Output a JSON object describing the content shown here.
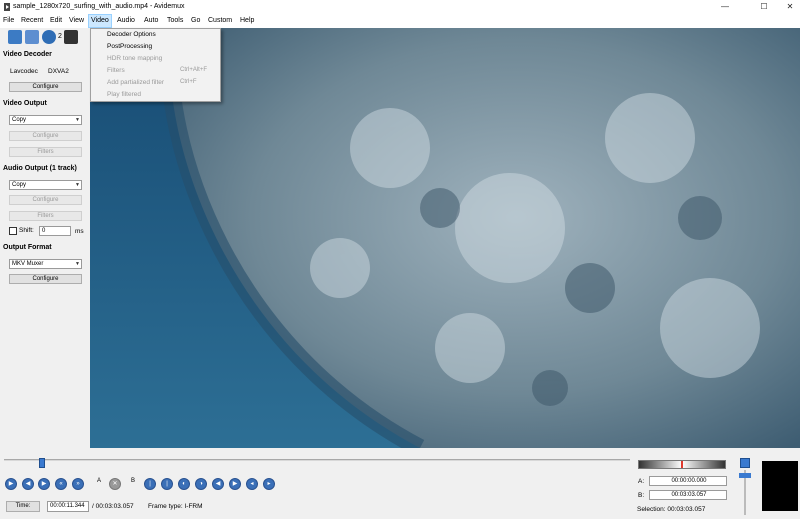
{
  "window": {
    "title": "sample_1280x720_surfing_with_audio.mp4 - Avidemux",
    "minimize": "—",
    "maximize": "☐",
    "close": "✕"
  },
  "menubar": {
    "items": [
      "File",
      "Recent",
      "Edit",
      "View",
      "Video",
      "Audio",
      "Auto",
      "Tools",
      "Go",
      "Custom",
      "Help"
    ]
  },
  "video_menu": {
    "items": [
      {
        "label": "Decoder Options",
        "shortcut": ""
      },
      {
        "label": "PostProcessing",
        "shortcut": ""
      },
      {
        "label": "HDR tone mapping",
        "shortcut": ""
      },
      {
        "label": "Filters",
        "shortcut": "Ctrl+Alt+F"
      },
      {
        "label": "Add partialized filter",
        "shortcut": "Ctrl+F"
      },
      {
        "label": "Play filtered",
        "shortcut": ""
      }
    ]
  },
  "toolbar": {
    "partial_label": "2"
  },
  "left_panel": {
    "video_decoder": {
      "title": "Video Decoder",
      "decoder": "Lavcodec",
      "hw": "DXVA2",
      "configure": "Configure"
    },
    "video_output": {
      "title": "Video Output",
      "codec": "Copy",
      "configure": "Configure",
      "filters": "Filters"
    },
    "audio_output": {
      "title": "Audio Output (1 track)",
      "codec": "Copy",
      "configure": "Configure",
      "filters": "Filters",
      "shift_label": "Shift:",
      "shift_value": "0",
      "shift_unit": "ms"
    },
    "output_format": {
      "title": "Output Format",
      "muxer": "MKV Muxer",
      "configure": "Configure"
    }
  },
  "playback": {
    "time_button": "Time:",
    "current_time": "00:00:11.344",
    "total_time": "/ 00:03:03.057",
    "frame_type": "Frame type:  I-FRM",
    "position_fraction": 0.061
  },
  "selection": {
    "a_label": "A:",
    "a_time": "00:00:00.000",
    "b_label": "B:",
    "b_time": "00:03:03.057",
    "selection_text": "Selection: 00:03:03.057"
  },
  "controls": {
    "mark_a": "A",
    "mark_b": "B"
  },
  "colors": {
    "accent": "#3a6fb7",
    "menu_highlight": "#cce8ff",
    "volume_marker": "#e03a2f"
  }
}
